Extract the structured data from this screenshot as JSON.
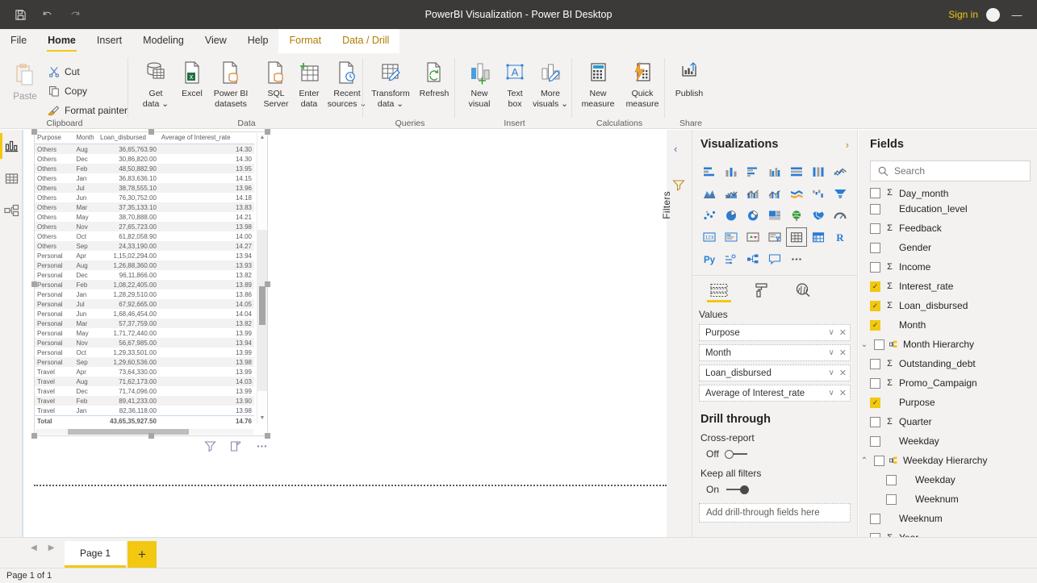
{
  "titlebar": {
    "title": "PowerBI Visualization - Power BI Desktop",
    "save_icon": "save-icon",
    "undo_icon": "undo-icon",
    "redo_icon": "redo-icon",
    "signin": "Sign in",
    "minimize": "—"
  },
  "ribbon": {
    "tabs": [
      {
        "label": "File",
        "state": "normal"
      },
      {
        "label": "Home",
        "state": "active"
      },
      {
        "label": "Insert",
        "state": "normal"
      },
      {
        "label": "Modeling",
        "state": "normal"
      },
      {
        "label": "View",
        "state": "normal"
      },
      {
        "label": "Help",
        "state": "normal"
      },
      {
        "label": "Format",
        "state": "contextual"
      },
      {
        "label": "Data / Drill",
        "state": "contextual"
      }
    ],
    "groups": [
      {
        "name": "Clipboard"
      },
      {
        "name": "Data"
      },
      {
        "name": "Queries"
      },
      {
        "name": "Insert"
      },
      {
        "name": "Calculations"
      },
      {
        "name": "Share"
      }
    ],
    "clipboard": {
      "paste": "Paste",
      "cut": "Cut",
      "copy": "Copy",
      "format_painter": "Format painter"
    },
    "data": {
      "get_data_l1": "Get",
      "get_data_l2": "data ⌄",
      "excel": "Excel",
      "pbi_l1": "Power BI",
      "pbi_l2": "datasets",
      "sql_l1": "SQL",
      "sql_l2": "Server",
      "enter_l1": "Enter",
      "enter_l2": "data",
      "recent_l1": "Recent",
      "recent_l2": "sources ⌄"
    },
    "queries": {
      "transform_l1": "Transform",
      "transform_l2": "data ⌄",
      "refresh": "Refresh"
    },
    "insert": {
      "newvisual_l1": "New",
      "newvisual_l2": "visual",
      "textbox_l1": "Text",
      "textbox_l2": "box",
      "morevisuals_l1": "More",
      "morevisuals_l2": "visuals ⌄"
    },
    "calculations": {
      "newmeasure_l1": "New",
      "newmeasure_l2": "measure",
      "quickmeasure_l1": "Quick",
      "quickmeasure_l2": "measure"
    },
    "share": {
      "publish": "Publish"
    }
  },
  "viewbar": {
    "items": [
      {
        "icon": "report-view-icon",
        "active": true
      },
      {
        "icon": "data-view-icon",
        "active": false
      },
      {
        "icon": "model-view-icon",
        "active": false
      }
    ]
  },
  "visual": {
    "type": "table",
    "columns": [
      "Purpose",
      "Month",
      "Loan_disbursed",
      "Average of Interest_rate"
    ],
    "rows": [
      [
        "Others",
        "Aug",
        "36,65,763.90",
        "14.30"
      ],
      [
        "Others",
        "Dec",
        "30,86,820.00",
        "14.30"
      ],
      [
        "Others",
        "Feb",
        "48,50,882.90",
        "13.95"
      ],
      [
        "Others",
        "Jan",
        "36,83,636.10",
        "14.15"
      ],
      [
        "Others",
        "Jul",
        "38,78,555.10",
        "13.96"
      ],
      [
        "Others",
        "Jun",
        "76,30,752.00",
        "14.18"
      ],
      [
        "Others",
        "Mar",
        "37,35,133.10",
        "13.83"
      ],
      [
        "Others",
        "May",
        "38,70,888.00",
        "14.21"
      ],
      [
        "Others",
        "Nov",
        "27,65,723.00",
        "13.98"
      ],
      [
        "Others",
        "Oct",
        "61,82,058.90",
        "14.00"
      ],
      [
        "Others",
        "Sep",
        "24,33,190.00",
        "14.27"
      ],
      [
        "Personal",
        "Apr",
        "1,15,02,294.00",
        "13.94"
      ],
      [
        "Personal",
        "Aug",
        "1,26,88,360.00",
        "13.93"
      ],
      [
        "Personal",
        "Dec",
        "96,11,866.00",
        "13.82"
      ],
      [
        "Personal",
        "Feb",
        "1,08,22,405.00",
        "13.89"
      ],
      [
        "Personal",
        "Jan",
        "1,28,29,510.00",
        "13.86"
      ],
      [
        "Personal",
        "Jul",
        "67,92,665.00",
        "14.05"
      ],
      [
        "Personal",
        "Jun",
        "1,68,46,454.00",
        "14.04"
      ],
      [
        "Personal",
        "Mar",
        "57,37,759.00",
        "13.82"
      ],
      [
        "Personal",
        "May",
        "1,71,72,440.00",
        "13.99"
      ],
      [
        "Personal",
        "Nov",
        "56,67,985.00",
        "13.94"
      ],
      [
        "Personal",
        "Oct",
        "1,29,33,501.00",
        "13.99"
      ],
      [
        "Personal",
        "Sep",
        "1,29,60,536.00",
        "13.98"
      ],
      [
        "Travel",
        "Apr",
        "73,64,330.00",
        "13.99"
      ],
      [
        "Travel",
        "Aug",
        "71,62,173.00",
        "14.03"
      ],
      [
        "Travel",
        "Dec",
        "71,74,096.00",
        "13.99"
      ],
      [
        "Travel",
        "Feb",
        "89,41,233.00",
        "13.90"
      ],
      [
        "Travel",
        "Jan",
        "82,36,118.00",
        "13.98"
      ]
    ],
    "total": [
      "Total",
      "",
      "43,65,35,927.50",
      "14.76"
    ],
    "tools": [
      "filter-icon",
      "focus-mode-icon",
      "more-options-icon"
    ]
  },
  "filters_pane": {
    "label": "Filters",
    "expand_icon": "chevron-left-icon",
    "filter_icon": "filter-icon"
  },
  "visualizations": {
    "title": "Visualizations",
    "expand_icon": "chevron-right-icon",
    "gallery": [
      "stacked-bar-chart-icon",
      "stacked-column-chart-icon",
      "clustered-bar-chart-icon",
      "clustered-column-chart-icon",
      "100-stacked-bar-chart-icon",
      "100-stacked-column-chart-icon",
      "line-chart-icon",
      "area-chart-icon",
      "stacked-area-chart-icon",
      "line-stacked-column-chart-icon",
      "line-clustered-column-chart-icon",
      "ribbon-chart-icon",
      "waterfall-chart-icon",
      "funnel-chart-icon",
      "scatter-chart-icon",
      "pie-chart-icon",
      "donut-chart-icon",
      "treemap-icon",
      "map-icon",
      "filled-map-icon",
      "gauge-icon",
      "card-icon",
      "multi-row-card-icon",
      "kpi-icon",
      "slicer-icon",
      "table-icon",
      "matrix-icon",
      "r-script-visual-icon",
      "python-visual-icon",
      "key-influencers-icon",
      "decomposition-tree-icon",
      "qa-visual-icon",
      "more-options-icon"
    ],
    "selected_gallery_index": 25,
    "tabs": [
      {
        "icon": "fields-pane-icon",
        "active": true
      },
      {
        "icon": "format-pane-icon",
        "active": false
      },
      {
        "icon": "analytics-pane-icon",
        "active": false
      }
    ],
    "values_title": "Values",
    "values": [
      "Purpose",
      "Month",
      "Loan_disbursed",
      "Average of Interest_rate"
    ],
    "drill_through": {
      "title": "Drill through",
      "cross_report_label": "Cross-report",
      "cross_report_state": "Off",
      "keep_filters_label": "Keep all filters",
      "keep_filters_state": "On",
      "dropzone": "Add drill-through fields here"
    }
  },
  "fields": {
    "title": "Fields",
    "search_placeholder": "Search",
    "search_icon": "search-icon",
    "items": [
      {
        "label": "Day_month",
        "checked": false,
        "measure": true,
        "clipped": true,
        "indent": 0
      },
      {
        "label": "Education_level",
        "checked": false,
        "measure": false,
        "indent": 0
      },
      {
        "label": "Feedback",
        "checked": false,
        "measure": true,
        "indent": 0
      },
      {
        "label": "Gender",
        "checked": false,
        "measure": false,
        "indent": 0
      },
      {
        "label": "Income",
        "checked": false,
        "measure": true,
        "indent": 0
      },
      {
        "label": "Interest_rate",
        "checked": true,
        "measure": true,
        "indent": 0
      },
      {
        "label": "Loan_disbursed",
        "checked": true,
        "measure": true,
        "indent": 0
      },
      {
        "label": "Month",
        "checked": true,
        "measure": false,
        "indent": 0
      },
      {
        "label": "Month Hierarchy",
        "checked": false,
        "hierarchy": true,
        "expander": "collapsed",
        "indent": 0
      },
      {
        "label": "Outstanding_debt",
        "checked": false,
        "measure": true,
        "indent": 0
      },
      {
        "label": "Promo_Campaign",
        "checked": false,
        "measure": true,
        "indent": 0
      },
      {
        "label": "Purpose",
        "checked": true,
        "measure": false,
        "indent": 0
      },
      {
        "label": "Quarter",
        "checked": false,
        "measure": true,
        "indent": 0
      },
      {
        "label": "Weekday",
        "checked": false,
        "measure": false,
        "indent": 0
      },
      {
        "label": "Weekday Hierarchy",
        "checked": false,
        "hierarchy": true,
        "expander": "expanded",
        "indent": 0
      },
      {
        "label": "Weekday",
        "checked": false,
        "measure": false,
        "indent": 1
      },
      {
        "label": "Weeknum",
        "checked": false,
        "measure": false,
        "indent": 1
      },
      {
        "label": "Weeknum",
        "checked": false,
        "measure": false,
        "indent": 0
      },
      {
        "label": "Year",
        "checked": false,
        "measure": true,
        "indent": 0
      }
    ]
  },
  "pagebar": {
    "prev_icon": "prev-page-icon",
    "next_icon": "next-page-icon",
    "tab": "Page 1",
    "add": "+"
  },
  "statusbar": {
    "text": "Page 1 of 1"
  },
  "colors": {
    "accent": "#f2c811",
    "titlebar": "#3b3a39",
    "chrome": "#f3f2f1",
    "contextual": "#b07d00"
  }
}
